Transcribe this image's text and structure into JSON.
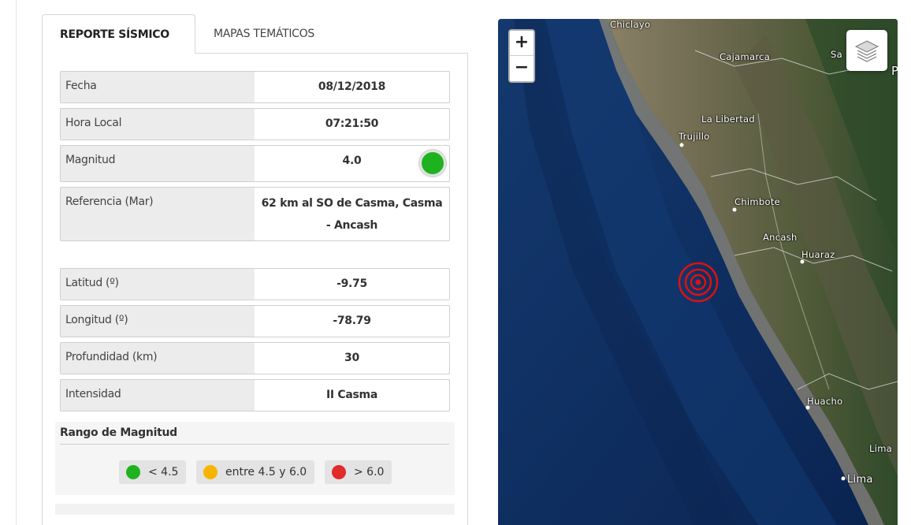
{
  "tabs": {
    "active": "REPORTE SÍSMICO",
    "inactive": "MAPAS TEMÁTICOS"
  },
  "report": {
    "fecha_label": "Fecha",
    "fecha_value": "08/12/2018",
    "hora_label": "Hora Local",
    "hora_value": "07:21:50",
    "magnitud_label": "Magnitud",
    "magnitud_value": "4.0",
    "referencia_label": "Referencia (Mar)",
    "referencia_value": "62 km al SO de Casma, Casma - Ancash",
    "latitud_label": "Latitud (º)",
    "latitud_value": "-9.75",
    "longitud_label": "Longitud (º)",
    "longitud_value": "-78.79",
    "profundidad_label": "Profundidad (km)",
    "profundidad_value": "30",
    "intensidad_label": "Intensidad",
    "intensidad_value": "II Casma"
  },
  "range": {
    "title": "Rango de Magnitud",
    "low": "< 4.5",
    "mid": "entre 4.5 y 6.0",
    "high": "> 6.0"
  },
  "colors": {
    "low": "#1eb31e",
    "mid": "#f7b500",
    "high": "#e12a2a",
    "epicenter": "#e01010"
  },
  "map": {
    "zoom_in": "+",
    "zoom_out": "−",
    "labels": {
      "chiclayo": "Chiclayo",
      "cajamarca": "Cajamarca",
      "sa": "Sa",
      "p": "P",
      "la_libertad": "La Libertad",
      "trujillo": "Trujillo",
      "chimbote": "Chimbote",
      "ancash": "Ancash",
      "huaraz": "Huaraz",
      "huacho": "Huacho",
      "lima_region": "Lima",
      "lima_city": "Lima"
    }
  }
}
